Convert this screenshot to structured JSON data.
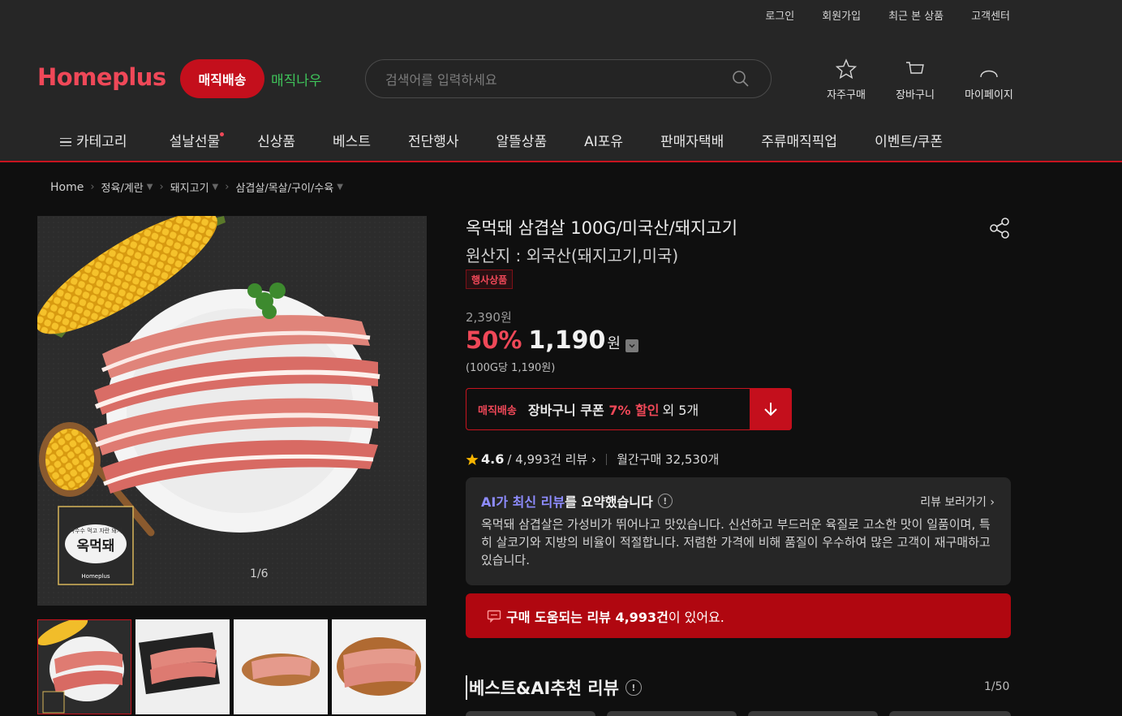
{
  "header": {
    "util_links": [
      "로그인",
      "회원가입",
      "최근 본 상품",
      "고객센터"
    ],
    "logo": "Homeplus",
    "magic_delivery": "매직배송",
    "magic_now": "매직나우",
    "search_placeholder": "검색어를 입력하세요",
    "icons": [
      {
        "label": "자주구매",
        "icon": "star-icon"
      },
      {
        "label": "장바구니",
        "icon": "cart-icon"
      },
      {
        "label": "마이페이지",
        "icon": "person-icon"
      }
    ]
  },
  "gnb": [
    "카테고리",
    "설날선물",
    "신상품",
    "베스트",
    "전단행사",
    "알뜰상품",
    "AI포유",
    "판매자택배",
    "주류매직픽업",
    "이벤트/쿠폰"
  ],
  "breadcrumb": [
    "Home",
    "정육/계란",
    "돼지고기",
    "삼겹살/목살/구이/수육"
  ],
  "gallery": {
    "counter": "1/6",
    "brand_sticker_top": "옥수수 먹고 자란 돼지",
    "brand_sticker": "옥먹돼",
    "brand_sticker_bottom": "Homeplus"
  },
  "product": {
    "title": "옥먹돼 삼겹살 100G/미국산/돼지고기",
    "origin": "원산지 : 외국산(돼지고기,미국)",
    "badge": "행사상품",
    "original_price": "2,390원",
    "discount_rate": "50%",
    "sale_price": "1,190",
    "won": "원",
    "unit_price": "(100G당 1,190원)"
  },
  "coupon": {
    "tag": "매직배송",
    "text": "장바구니 쿠폰",
    "highlight": "7% 할인",
    "etc": "외 5개"
  },
  "rating": {
    "score": "4.6",
    "reviews": "/ 4,993건 리뷰",
    "monthly": "월간구매 32,530개"
  },
  "ai_summary": {
    "title_ai": "AI가 최신 리뷰",
    "title_rest": "를 요약했습니다",
    "link": "리뷰 보러가기",
    "body": "옥먹돼 삼겹살은 가성비가 뛰어나고 맛있습니다. 신선하고 부드러운 육질로 고소한 맛이 일품이며, 특히 살코기와 지방의 비율이 적절합니다. 저렴한 가격에 비해 품질이 우수하여 많은 고객이 재구매하고 있습니다."
  },
  "review_banner": {
    "bold": "구매 도움되는 리뷰 4,993건",
    "rest": " 이 있어요."
  },
  "best_reviews": {
    "title": "베스트&AI추천 리뷰",
    "count": "1/50"
  },
  "colors": {
    "accent": "#c8141f",
    "brand_red": "#ef4858",
    "magic_green": "#3fc45a",
    "ai_purple": "#8e8cff"
  }
}
